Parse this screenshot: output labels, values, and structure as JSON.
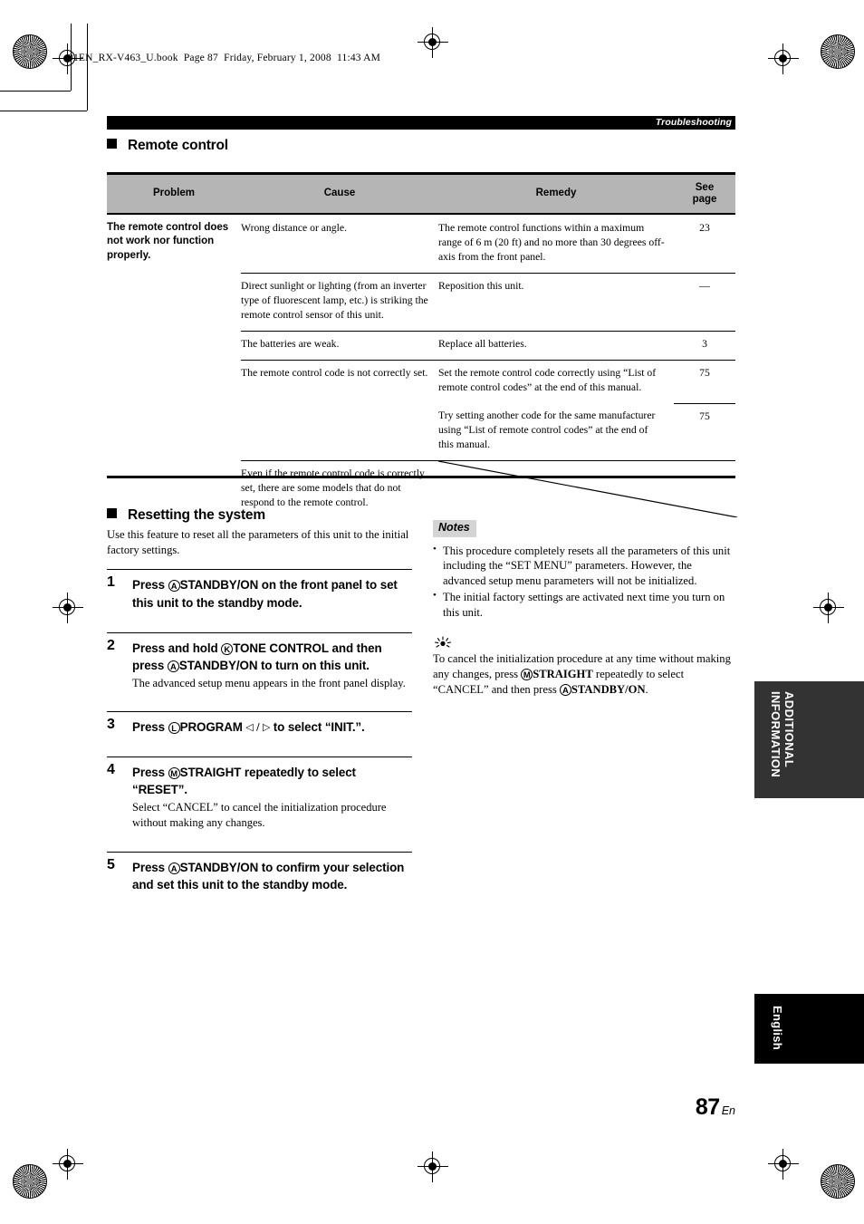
{
  "print_header": "01EN_RX-V463_U.book  Page 87  Friday, February 1, 2008  11:43 AM",
  "running_head": "Troubleshooting",
  "sections": {
    "remote_control_title": "Remote control",
    "resetting_title": "Resetting the system"
  },
  "table": {
    "headers": {
      "problem": "Problem",
      "cause": "Cause",
      "remedy": "Remedy",
      "see_page_line1": "See",
      "see_page_line2": "page"
    },
    "problem": "The remote control does not work nor function properly.",
    "rows": [
      {
        "cause": "Wrong distance or angle.",
        "remedy": "The remote control functions within a maximum range of 6 m (20 ft) and no more than 30 degrees off-axis from the front panel.",
        "page": "23"
      },
      {
        "cause": "Direct sunlight or lighting (from an inverter type of fluorescent lamp, etc.) is striking the remote control sensor of this unit.",
        "remedy": "Reposition this unit.",
        "page": "—"
      },
      {
        "cause": "The batteries are weak.",
        "remedy": "Replace all batteries.",
        "page": "3"
      },
      {
        "cause": "The remote control code is not correctly set.",
        "remedy": "Set the remote control code correctly using “List of remote control codes” at the end of this manual.",
        "page": "75"
      },
      {
        "cause": "",
        "remedy": "Try setting another code for the same manufacturer using “List of remote control codes” at the end of this manual.",
        "page": "75"
      },
      {
        "cause": "Even if the remote control code is correctly set, there are some models that do not respond to the remote control.",
        "remedy": "",
        "page": ""
      }
    ]
  },
  "resetting": {
    "intro": "Use this feature to reset all the parameters of this unit to the initial factory settings.",
    "steps": [
      {
        "num": "1",
        "title_parts": [
          {
            "t": "Press ",
            "k": "plain"
          },
          {
            "t": "A",
            "k": "circle"
          },
          {
            "t": "STANDBY/ON",
            "k": "heavy"
          },
          {
            "t": " on the front panel to set this unit to the standby mode.",
            "k": "plain"
          }
        ],
        "body": ""
      },
      {
        "num": "2",
        "title_parts": [
          {
            "t": "Press and hold ",
            "k": "plain"
          },
          {
            "t": "K",
            "k": "circle"
          },
          {
            "t": "TONE CONTROL",
            "k": "heavy"
          },
          {
            "t": " and then press ",
            "k": "plain"
          },
          {
            "t": "A",
            "k": "circle"
          },
          {
            "t": "STANDBY/ON",
            "k": "heavy"
          },
          {
            "t": " to turn on this unit.",
            "k": "plain"
          }
        ],
        "body": "The advanced setup menu appears in the front panel display."
      },
      {
        "num": "3",
        "title_parts": [
          {
            "t": "Press ",
            "k": "plain"
          },
          {
            "t": "L",
            "k": "circle"
          },
          {
            "t": "PROGRAM",
            "k": "heavy"
          },
          {
            "t": " ◁ / ▷ ",
            "k": "arrow"
          },
          {
            "t": "to select “INIT.”.",
            "k": "plain"
          }
        ],
        "body": ""
      },
      {
        "num": "4",
        "title_parts": [
          {
            "t": "Press ",
            "k": "plain"
          },
          {
            "t": "M",
            "k": "circle"
          },
          {
            "t": "STRAIGHT",
            "k": "heavy"
          },
          {
            "t": " repeatedly to select “RESET”.",
            "k": "plain"
          }
        ],
        "body": "Select “CANCEL” to cancel the initialization procedure without making any changes."
      },
      {
        "num": "5",
        "title_parts": [
          {
            "t": "Press ",
            "k": "plain"
          },
          {
            "t": "A",
            "k": "circle"
          },
          {
            "t": "STANDBY/ON",
            "k": "heavy"
          },
          {
            "t": " to confirm your selection and set this unit to the standby mode.",
            "k": "plain"
          }
        ],
        "body": ""
      }
    ]
  },
  "notes": {
    "label": "Notes",
    "items": [
      "This procedure completely resets all the parameters of this unit including the “SET MENU” parameters. However, the advanced setup menu parameters will not be initialized.",
      "The initial factory settings are activated next time you turn on this unit."
    ]
  },
  "tip": {
    "parts": [
      {
        "t": "To cancel the initialization procedure at any time without making any changes, press ",
        "k": "plain"
      },
      {
        "t": "M",
        "k": "circle"
      },
      {
        "t": "STRAIGHT",
        "k": "heavy"
      },
      {
        "t": " repeatedly to select “CANCEL” and then press ",
        "k": "plain"
      },
      {
        "t": "A",
        "k": "circle"
      },
      {
        "t": "STANDBY/ON",
        "k": "heavy"
      },
      {
        "t": ".",
        "k": "plain"
      }
    ]
  },
  "side_tabs": {
    "additional": "ADDITIONAL\nINFORMATION",
    "english": "English"
  },
  "folio": {
    "page_number": "87",
    "suffix": "En"
  },
  "colors": {
    "table_header_bg": "#b5b5b5",
    "notes_label_bg": "#d4d4d4",
    "tab_additional_bg": "#333333",
    "tab_english_bg": "#000000"
  }
}
